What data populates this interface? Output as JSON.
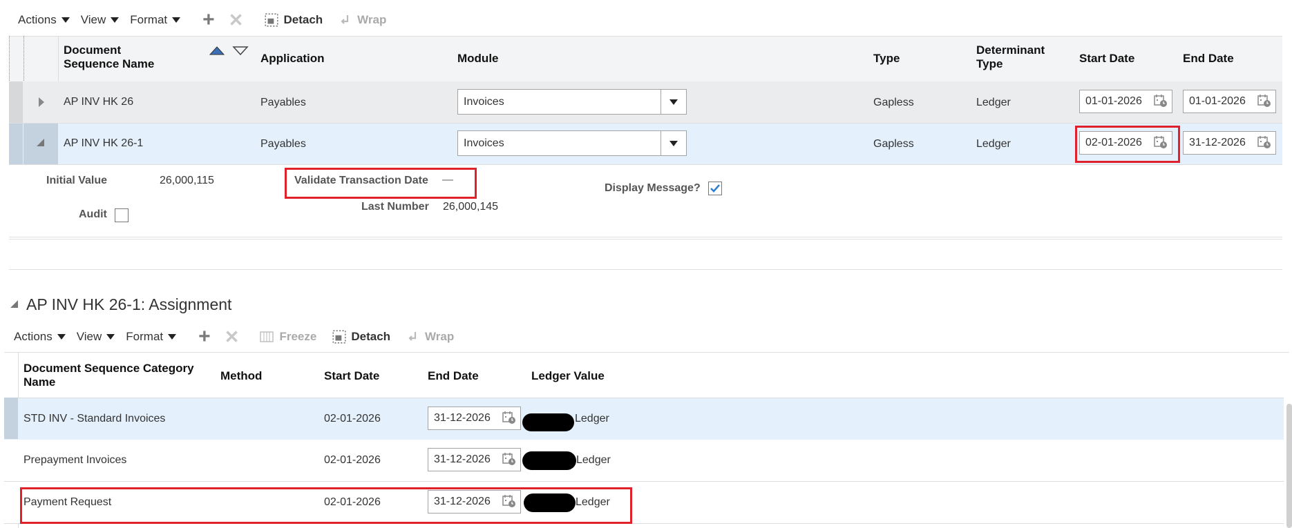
{
  "toolbar1": {
    "actions": "Actions",
    "view": "View",
    "format": "Format",
    "detach": "Detach",
    "wrap": "Wrap"
  },
  "table1": {
    "headers": {
      "name": "Document Sequence Name",
      "application": "Application",
      "module": "Module",
      "type": "Type",
      "determinant_type": "Determinant Type",
      "start_date": "Start Date",
      "end_date": "End Date"
    },
    "rows": [
      {
        "name": "AP INV HK 26",
        "application": "Payables",
        "module": "Invoices",
        "type": "Gapless",
        "determinant_type": "Ledger",
        "start_date": "01-01-2026",
        "end_date": "01-01-2026"
      },
      {
        "name": "AP INV HK 26-1",
        "application": "Payables",
        "module": "Invoices",
        "type": "Gapless",
        "determinant_type": "Ledger",
        "start_date": "02-01-2026",
        "end_date": "31-12-2026"
      }
    ]
  },
  "detail": {
    "initial_value_label": "Initial Value",
    "initial_value": "26,000,115",
    "validate_label": "Validate Transaction Date",
    "validate_value": "—",
    "display_message_label": "Display Message?",
    "display_message_checked": true,
    "audit_label": "Audit",
    "audit_checked": false,
    "last_number_label": "Last Number",
    "last_number": "26,000,145"
  },
  "assignment": {
    "title": "AP INV HK 26-1: Assignment",
    "toolbar": {
      "actions": "Actions",
      "view": "View",
      "format": "Format",
      "freeze": "Freeze",
      "detach": "Detach",
      "wrap": "Wrap"
    },
    "headers": {
      "category": "Document Sequence Category Name",
      "method": "Method",
      "start_date": "Start Date",
      "end_date": "End Date",
      "ledger_value": "Ledger Value"
    },
    "rows": [
      {
        "category": "STD INV - Standard Invoices",
        "method": "",
        "start_date": "02-01-2026",
        "end_date": "31-12-2026",
        "ledger_value": "Ledger"
      },
      {
        "category": "Prepayment Invoices",
        "method": "",
        "start_date": "02-01-2026",
        "end_date": "31-12-2026",
        "ledger_value": "Ledger"
      },
      {
        "category": "Payment Request",
        "method": "",
        "start_date": "02-01-2026",
        "end_date": "31-12-2026",
        "ledger_value": "Ledger"
      }
    ]
  },
  "colors": {
    "selected_row": "#e4f0fb",
    "header_bg": "#f3f4f5",
    "highlight": "#e0202a",
    "check_blue": "#2a7fd4"
  }
}
